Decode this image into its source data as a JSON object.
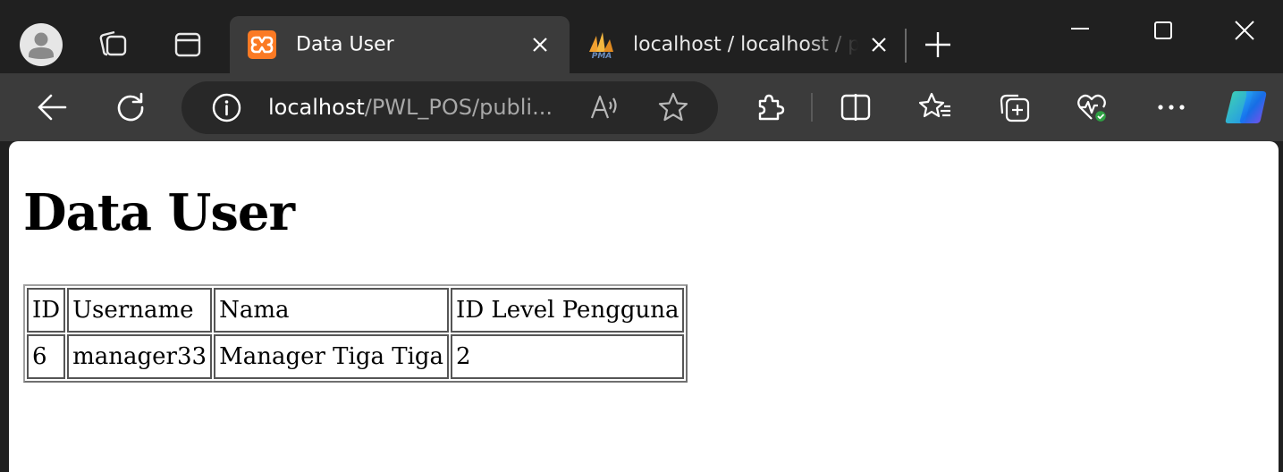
{
  "browser": {
    "tabs": [
      {
        "title": "Data User",
        "active": true,
        "favicon": "xampp-icon"
      },
      {
        "title": "localhost / localhost / p",
        "active": false,
        "favicon": "phpmyadmin-icon"
      }
    ],
    "address": {
      "host": "localhost",
      "path": "/PWL_POS/publi..."
    },
    "colors": {
      "frame": "#202020",
      "toolbar": "#3b3b3b",
      "xampp": "#fb7a24"
    }
  },
  "page": {
    "title": "Data User",
    "table": {
      "headers": [
        "ID",
        "Username",
        "Nama",
        "ID Level Pengguna"
      ],
      "rows": [
        [
          "6",
          "manager33",
          "Manager Tiga Tiga",
          "2"
        ]
      ]
    }
  }
}
